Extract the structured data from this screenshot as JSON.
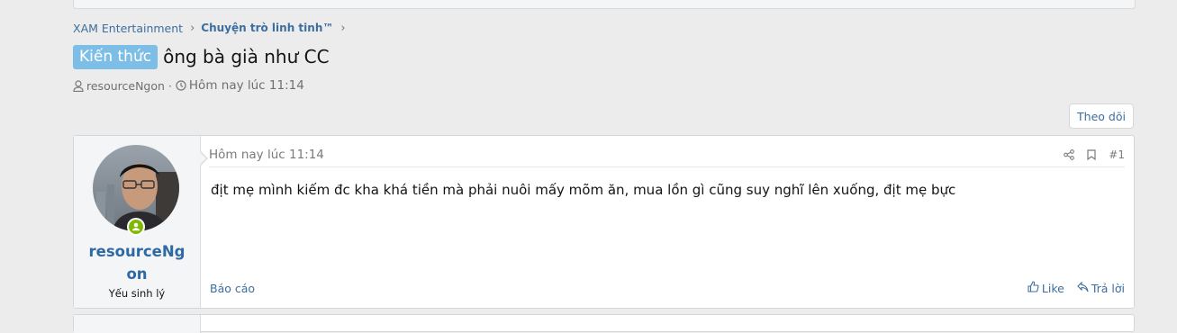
{
  "breadcrumb": {
    "items": [
      "XAM Entertainment",
      "Chuyện trò linh tinh™"
    ]
  },
  "thread": {
    "prefix": "Kiến thức",
    "title": "ông bà già như CC",
    "author": "resourceNgon",
    "date": "Hôm nay lúc 11:14",
    "follow_label": "Theo dõi"
  },
  "post": {
    "time": "Hôm nay lúc 11:14",
    "number": "#1",
    "body": "địt mẹ mình kiếm đc kha khá tiền mà phải nuôi mấy mõm ăn, mua lồn gì cũng suy nghĩ lên xuống, địt mẹ bực",
    "username": "resourceNgon",
    "user_title": "Yếu sinh lý",
    "report_label": "Báo cáo",
    "like_label": "Like",
    "reply_label": "Trả lời",
    "online": true
  },
  "colors": {
    "link": "#3c6e9f",
    "prefix_bg": "#7dbee6",
    "online": "#7fb900",
    "page_bg": "#ececec"
  },
  "icons": {
    "breadcrumb_sep": "chevron-right-icon",
    "author": "user-icon",
    "date": "clock-icon",
    "share": "share-icon",
    "bookmark": "bookmark-icon",
    "like": "thumbs-up-icon",
    "reply": "reply-icon",
    "online": "online-status-icon"
  }
}
